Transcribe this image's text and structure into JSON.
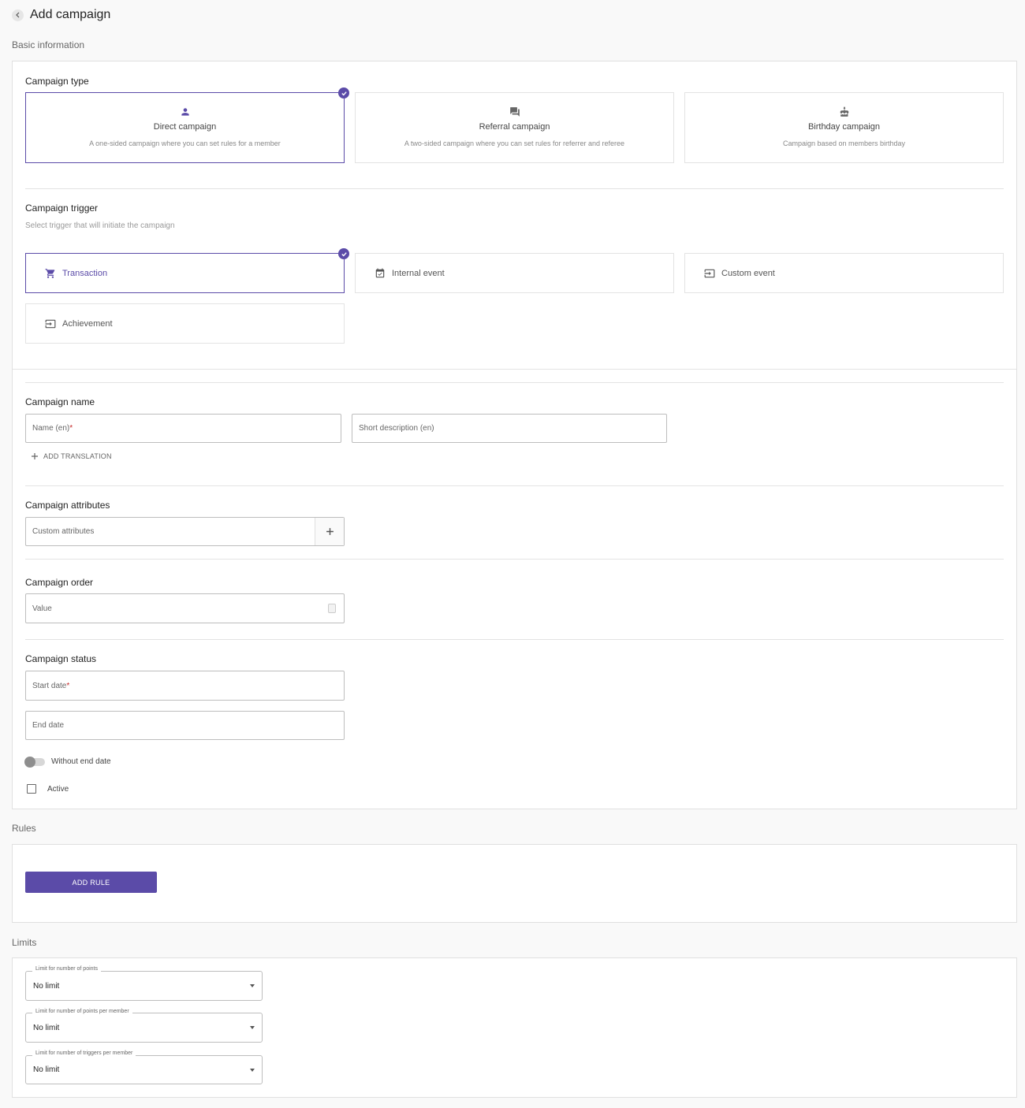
{
  "header": {
    "title": "Add campaign"
  },
  "sections": {
    "basic_info": "Basic information",
    "rules": "Rules",
    "limits": "Limits"
  },
  "campaign_type": {
    "title": "Campaign type",
    "options": [
      {
        "name": "Direct campaign",
        "description": "A one-sided campaign where you can set rules for a member",
        "icon": "person-icon",
        "selected": true
      },
      {
        "name": "Referral campaign",
        "description": "A two-sided campaign where you can set rules for referrer and referee",
        "icon": "chat-icon",
        "selected": false
      },
      {
        "name": "Birthday campaign",
        "description": "Campaign based on members birthday",
        "icon": "cake-icon",
        "selected": false
      }
    ]
  },
  "campaign_trigger": {
    "title": "Campaign trigger",
    "hint": "Select trigger that will initiate the campaign",
    "options": [
      {
        "label": "Transaction",
        "icon": "cart-icon",
        "selected": true
      },
      {
        "label": "Internal event",
        "icon": "calendar-check-icon",
        "selected": false
      },
      {
        "label": "Custom event",
        "icon": "input-icon",
        "selected": false
      },
      {
        "label": "Achievement",
        "icon": "input-icon",
        "selected": false
      }
    ]
  },
  "campaign_name": {
    "title": "Campaign name",
    "name_placeholder": "Name (en)",
    "required_mark": "*",
    "short_desc_placeholder": "Short description (en)",
    "add_translation": "ADD TRANSLATION"
  },
  "campaign_attributes": {
    "title": "Campaign attributes",
    "placeholder": "Custom attributes"
  },
  "campaign_order": {
    "title": "Campaign order",
    "placeholder": "Value"
  },
  "campaign_status": {
    "title": "Campaign status",
    "start_placeholder": "Start date",
    "required_mark": "*",
    "end_placeholder": "End date",
    "without_end_label": "Without end date",
    "active_label": "Active"
  },
  "rules": {
    "add_button": "ADD RULE"
  },
  "limits": [
    {
      "label": "Limit for number of points",
      "value": "No limit"
    },
    {
      "label": "Limit for number of points per member",
      "value": "No limit"
    },
    {
      "label": "Limit for number of triggers per member",
      "value": "No limit"
    }
  ],
  "colors": {
    "accent": "#5b4ba8",
    "required": "#c62828"
  }
}
